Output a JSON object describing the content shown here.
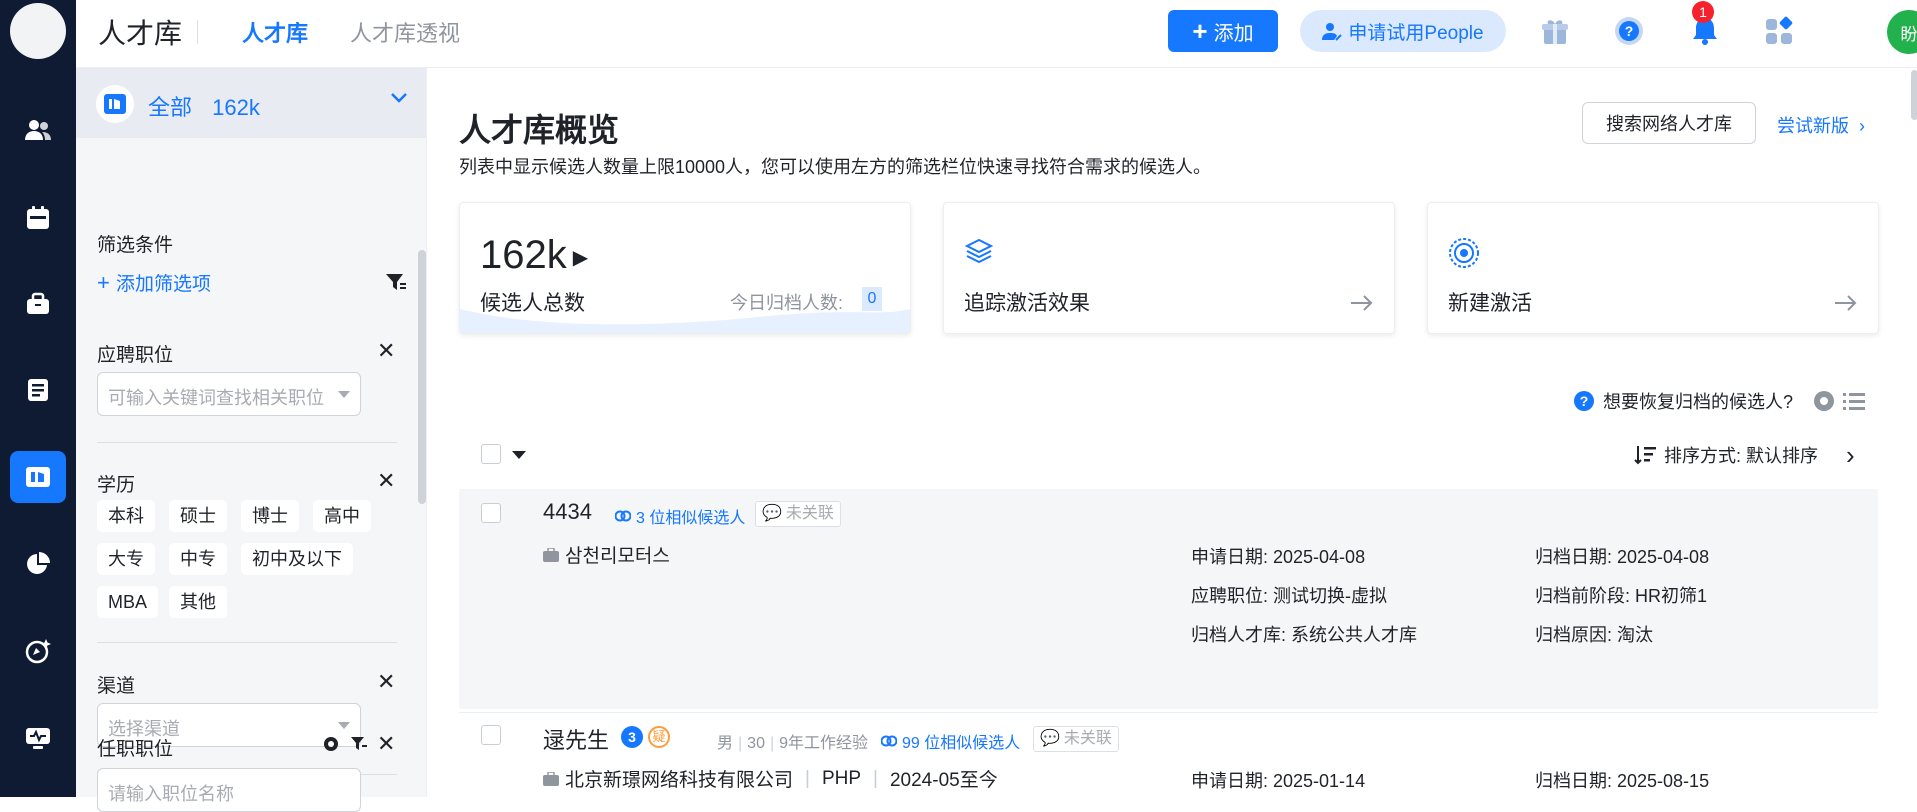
{
  "topbar": {
    "brand": "人才库",
    "tabs": [
      "人才库",
      "人才库透视"
    ],
    "add_button": "添加",
    "trial_button": "申请试用People",
    "notification_count": "1",
    "user_avatar": "盼"
  },
  "sidebar": {
    "all_label": "全部",
    "all_count": "162k",
    "filter_title": "筛选条件",
    "add_filter": "添加筛选项",
    "position_section": {
      "title": "应聘职位",
      "placeholder": "可输入关键词查找相关职位"
    },
    "education_section": {
      "title": "学历",
      "options": [
        "本科",
        "硕士",
        "博士",
        "高中",
        "大专",
        "中专",
        "初中及以下",
        "MBA",
        "其他"
      ]
    },
    "channel_section": {
      "title": "渠道",
      "placeholder": "选择渠道"
    },
    "job_title_section": {
      "title": "任职职位",
      "placeholder": "请输入职位名称"
    }
  },
  "main": {
    "title": "人才库概览",
    "subtitle": "列表中显示候选人数量上限10000人，您可以使用左方的筛选栏位快速寻找符合需求的候选人。",
    "search_network_button": "搜索网络人才库",
    "try_new_link": "尝试新版",
    "stats": {
      "total": "162k",
      "total_label": "候选人总数",
      "today_label": "今日归档人数:",
      "today_value": "0"
    },
    "cards": [
      {
        "label": "追踪激活效果",
        "icon": "layers-icon"
      },
      {
        "label": "新建激活",
        "icon": "target-icon"
      }
    ],
    "restore_link": "想要恢复归档的候选人?",
    "sort_label": "排序方式: 默认排序",
    "candidates": [
      {
        "name": "4434",
        "similar": "3 位相似候选人",
        "unlinked": "未关联",
        "company": "삼천리모터스",
        "apply_date": "申请日期: 2025-04-08",
        "archive_date": "归档日期: 2025-04-08",
        "position": "应聘职位: 测试切换-虚拟",
        "prev_stage": "归档前阶段: HR初筛1",
        "archive_pool": "归档人才库: 系统公共人才库",
        "archive_reason": "归档原因: 淘汰"
      },
      {
        "name": "逯先生",
        "count_badge": "3",
        "doubt_badge": "疑",
        "gender": "男",
        "age": "30",
        "experience": "9年工作经验",
        "similar": "99 位相似候选人",
        "unlinked": "未关联",
        "company": "北京新璟网络科技有限公司",
        "role": "PHP",
        "period": "2024-05至今",
        "apply_date": "申请日期: 2025-01-14",
        "archive_date": "归档日期: 2025-08-15"
      }
    ]
  },
  "colors": {
    "primary": "#1677ff",
    "nav_bg": "#0f1b33",
    "sidebar_bg": "#f5f6f8"
  }
}
